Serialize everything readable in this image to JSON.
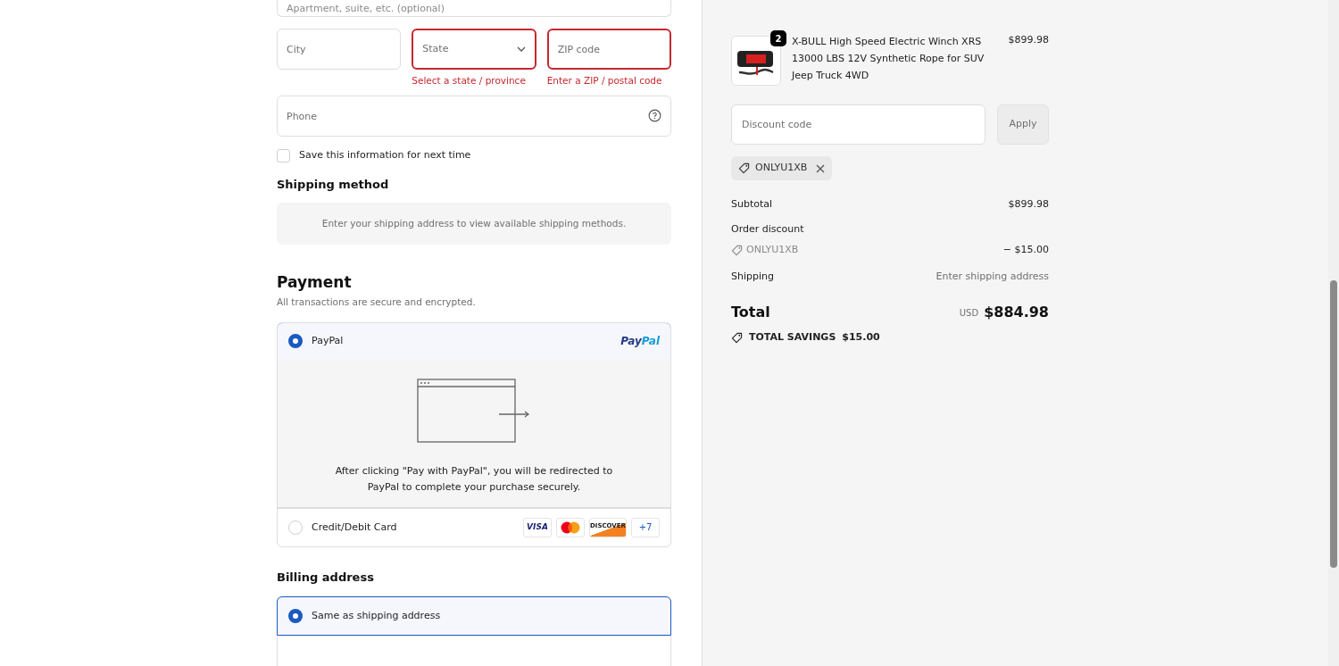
{
  "address": {
    "apartment": {
      "placeholder": "Apartment, suite, etc. (optional)"
    },
    "city": {
      "placeholder": "City",
      "error": false
    },
    "state": {
      "placeholder": "State",
      "error": true,
      "error_text": "Select a state / province"
    },
    "zip": {
      "placeholder": "ZIP code",
      "error": true,
      "error_text": "Enter a ZIP / postal code"
    },
    "phone": {
      "placeholder": "Phone"
    },
    "save_info": {
      "label": "Save this information for next time",
      "checked": false
    }
  },
  "shipping_method": {
    "title": "Shipping method",
    "notice": "Enter your shipping address to view available shipping methods."
  },
  "payment": {
    "title": "Payment",
    "subtitle": "All transactions are secure and encrypted.",
    "methods": [
      {
        "label": "PayPal",
        "selected": true,
        "kind": "paypal",
        "logo": [
          "Pay",
          "Pal"
        ],
        "note": "After clicking \"Pay with PayPal\", you will be redirected to PayPal to complete your purchase securely."
      },
      {
        "label": "Credit/Debit Card",
        "selected": false,
        "kind": "card",
        "brands": [
          "VISA",
          "DISCOVER"
        ],
        "more": "+7"
      }
    ]
  },
  "billing": {
    "title": "Billing address",
    "options": [
      {
        "label": "Same as shipping address",
        "selected": true
      }
    ]
  },
  "summary": {
    "item": {
      "quantity": "2",
      "name": "X-BULL High Speed Electric Winch XRS 13000 LBS 12V Synthetic Rope for SUV Jeep Truck 4WD",
      "price": "$899.98"
    },
    "discount": {
      "placeholder": "Discount code",
      "button": "Apply",
      "applied": "ONLYU1XB"
    },
    "subtotal": {
      "label": "Subtotal",
      "value": "$899.98"
    },
    "order_discount": {
      "label": "Order discount",
      "code": "ONLYU1XB",
      "value": "− $15.00"
    },
    "shipping": {
      "label": "Shipping",
      "value": "Enter shipping address"
    },
    "total": {
      "label": "Total",
      "currency": "USD",
      "value": "$884.98"
    },
    "savings": {
      "label": "TOTAL SAVINGS",
      "value": "$15.00"
    }
  }
}
